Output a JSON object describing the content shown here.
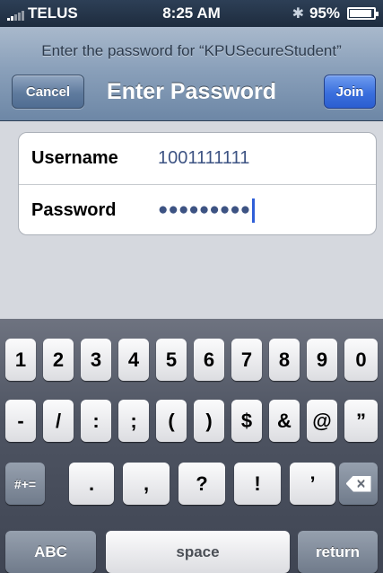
{
  "status_bar": {
    "carrier": "TELUS",
    "time": "8:25 AM",
    "bluetooth_icon": "bluetooth-icon",
    "battery": "95%",
    "battery_icon": "battery-icon",
    "signal_icon": "signal-bars-icon"
  },
  "nav": {
    "prompt": "Enter the password for “KPUSecureStudent”",
    "title": "Enter Password",
    "cancel_label": "Cancel",
    "join_label": "Join"
  },
  "form": {
    "username_label": "Username",
    "username_value": "1001111111",
    "password_label": "Password",
    "password_mask": "●●●●●●●●●"
  },
  "keyboard": {
    "row1": [
      "1",
      "2",
      "3",
      "4",
      "5",
      "6",
      "7",
      "8",
      "9",
      "0"
    ],
    "row2": [
      "-",
      "/",
      ":",
      ";",
      "(",
      ")",
      "$",
      "&",
      "@",
      "”"
    ],
    "row3_shift": "#+=",
    "row3": [
      ".",
      ",",
      "?",
      "!",
      "’"
    ],
    "backspace_icon": "backspace-icon",
    "abc_label": "ABC",
    "space_label": "space",
    "return_label": "return"
  },
  "colors": {
    "join_button": "#3a6fdd",
    "input_text": "#3d5383",
    "cursor": "#2f5fd8"
  }
}
